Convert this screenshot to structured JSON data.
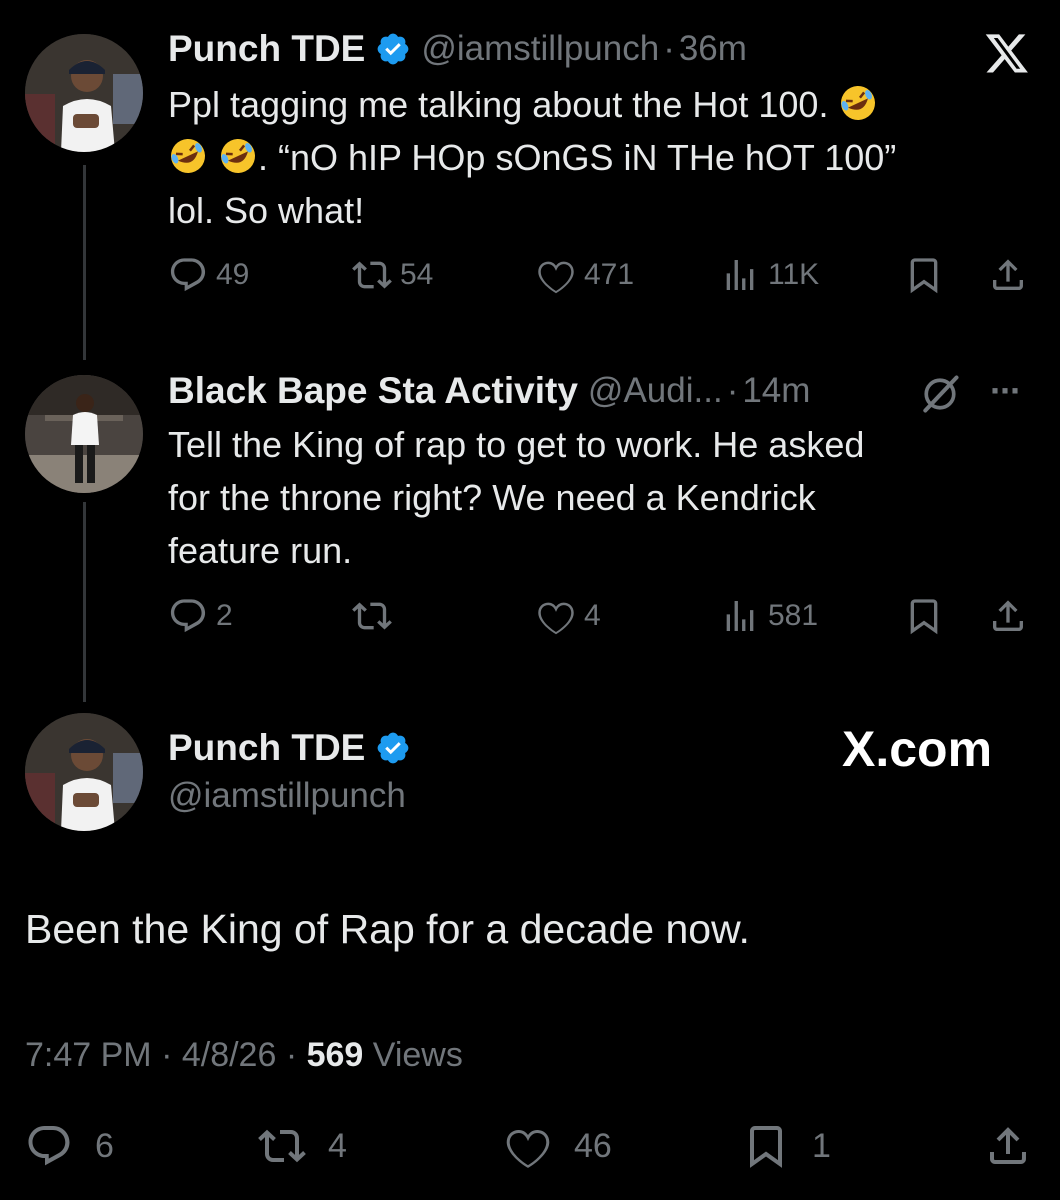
{
  "tweet1": {
    "name": "Punch TDE",
    "handle": "@iamstillpunch",
    "separator": "·",
    "time": "36m",
    "text_line1": "Ppl tagging me talking about the Hot 100. ",
    "text_line2_suffix": ". “nO hIP HOp sOnGS iN THe hOT 100”",
    "text_line3": "lol. So what!",
    "replies": "49",
    "reposts": "54",
    "likes": "471",
    "views": "11K",
    "emoji": "rolling-on-floor-laughing"
  },
  "tweet2": {
    "name": "Black Bape Sta Activity",
    "handle": "@Audi...",
    "separator": "·",
    "time": "14m",
    "text_line1": "Tell the King of rap to get to work. He asked",
    "text_line2": "for the throne right? We need a Kendrick",
    "text_line3": "feature run.",
    "replies": "2",
    "reposts": "",
    "likes": "4",
    "views": "581",
    "more": "···"
  },
  "main_tweet": {
    "name": "Punch TDE",
    "handle": "@iamstillpunch",
    "watermark": "X.com",
    "text": "Been the King of Rap for a decade now.",
    "time": "7:47 PM",
    "sep1": " · ",
    "date": "4/8/26",
    "sep2": " · ",
    "views_count": "569",
    "views_label": " Views",
    "replies": "6",
    "reposts": "4",
    "likes": "46",
    "bookmarks": "1"
  },
  "colors": {
    "background": "#000000",
    "text": "#e7e9ea",
    "muted": "#71767b",
    "verified": "#1d9bf0",
    "thread_line": "#333639"
  },
  "icons": [
    "x-logo-icon",
    "verified-icon",
    "reply-icon",
    "repost-icon",
    "like-icon",
    "views-icon",
    "bookmark-icon",
    "share-icon",
    "grok-icon",
    "more-icon"
  ]
}
